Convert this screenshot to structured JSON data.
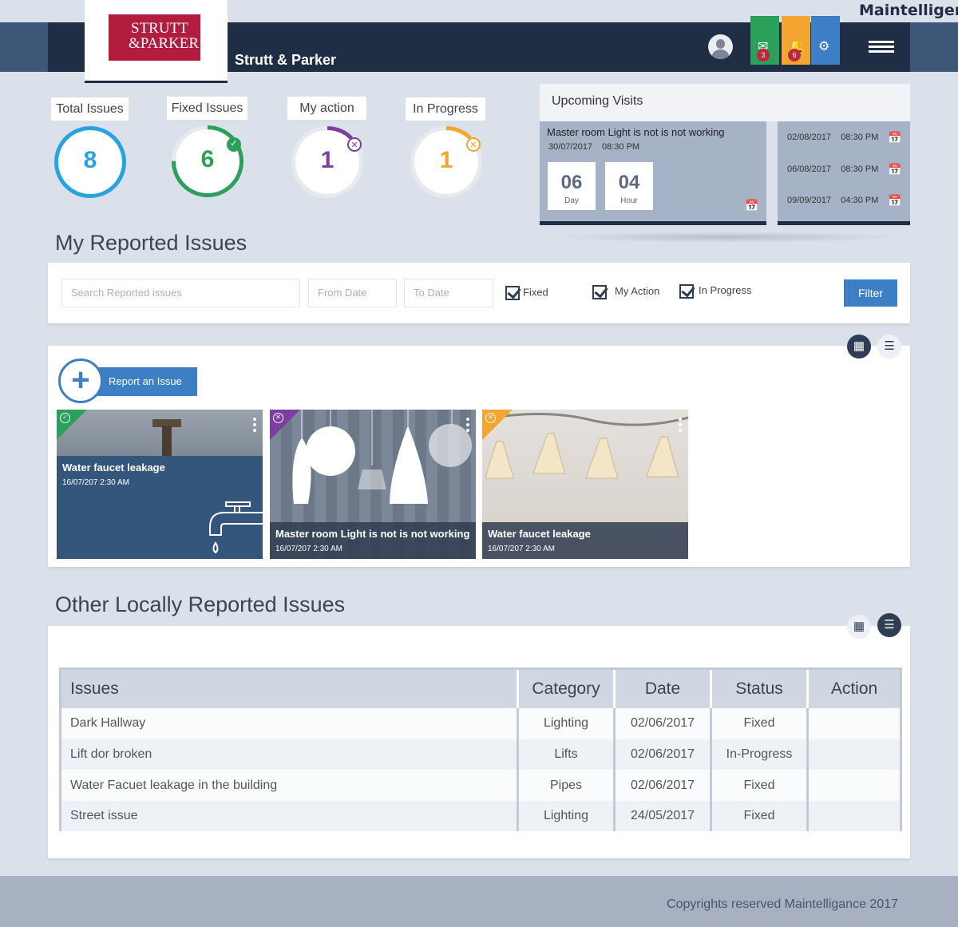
{
  "header": {
    "brand": "Maintelligence",
    "logo_line1": "STRUTT",
    "logo_line2": "&PARKER",
    "company": "Strutt & Parker",
    "mail_count": "3",
    "alert_count": "6",
    "colors": {
      "navy": "#1f2e45",
      "green": "#2aa05a",
      "orange": "#f2a531",
      "blue": "#3d7fc4",
      "logo_red": "#b11c3f"
    }
  },
  "stats": [
    {
      "label": "Total Issues",
      "value": "8",
      "color": "#29a3e0",
      "progress": 1.0
    },
    {
      "label": "Fixed Issues",
      "value": "6",
      "color": "#2aa05a",
      "progress": 0.75
    },
    {
      "label": "My action",
      "value": "1",
      "color": "#7b3fa0",
      "progress": 0.125
    },
    {
      "label": "In Progress",
      "value": "1",
      "color": "#f2a531",
      "progress": 0.125
    }
  ],
  "upcoming": {
    "title": "Upcoming Visits",
    "main_title": "Master room Light is not is not working",
    "main_date": "30/07/2017",
    "main_time": "08:30 PM",
    "days": "06",
    "days_label": "Day",
    "hours": "04",
    "hours_label": "Hour",
    "visits": [
      {
        "date": "02/08/2017",
        "time": "08:30 PM"
      },
      {
        "date": "06/08/2017",
        "time": "08:30 PM"
      },
      {
        "date": "09/09/2017",
        "time": "04:30 PM"
      }
    ]
  },
  "my_issues": {
    "title": "My Reported Issues",
    "search_placeholder": "Search Reported issues",
    "from_placeholder": "From Date",
    "to_placeholder": "To Date",
    "chk_fixed": "Fixed",
    "chk_action": "My Action",
    "chk_progress": "In Progress",
    "filter_label": "Filter",
    "report_label": "Report an Issue",
    "cards": [
      {
        "title": "Water faucet leakage",
        "date": "16/07/207  2:30 AM",
        "status_color": "#2aa05a",
        "icon": "faucet-icon"
      },
      {
        "title": "Master room Light is not is not working",
        "date": "16/07/207  2:30 AM",
        "status_color": "#7b3fa0",
        "icon": "pendant-lamps"
      },
      {
        "title": "Water faucet leakage",
        "date": "16/07/207  2:30 AM",
        "status_color": "#f2a531",
        "icon": "ceiling-lamps"
      }
    ]
  },
  "other_issues": {
    "title": "Other Locally Reported Issues",
    "headers": {
      "issues": "Issues",
      "category": "Category",
      "date": "Date",
      "status": "Status",
      "action": "Action"
    },
    "rows": [
      {
        "issue": "Dark Hallway",
        "category": "Lighting",
        "date": "02/06/2017",
        "status": "Fixed"
      },
      {
        "issue": "Lift dor broken",
        "category": "Lifts",
        "date": "02/06/2017",
        "status": "In-Progress"
      },
      {
        "issue": "Water Facuet leakage in the building",
        "category": "Pipes",
        "date": "02/06/2017",
        "status": "Fixed"
      },
      {
        "issue": "Street issue",
        "category": "Lighting",
        "date": "24/05/2017",
        "status": "Fixed"
      }
    ]
  },
  "footer": {
    "copyright": "Copyrights reserved Maintelligance 2017"
  }
}
